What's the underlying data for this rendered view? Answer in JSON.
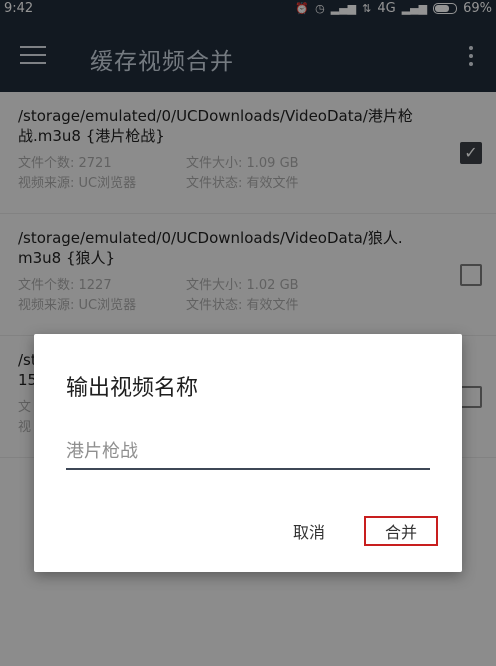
{
  "status_bar": {
    "time": "9:42",
    "network": "4G",
    "battery_level_percent": 69,
    "battery_label": "69%",
    "icons": [
      "alarm-icon",
      "clock-icon",
      "signal-icon",
      "data-arrows-icon",
      "signal-icon",
      "battery-icon"
    ]
  },
  "app_bar": {
    "title": "缓存视频合并"
  },
  "items": [
    {
      "path": "/storage/emulated/0/UCDownloads/VideoData/港片枪战.m3u8 {港片枪战}",
      "file_count": "文件个数: 2721",
      "file_size": "文件大小: 1.09 GB",
      "source": "视频来源: UC浏览器",
      "status": "文件状态: 有效文件",
      "checked": true
    },
    {
      "path": "/storage/emulated/0/UCDownloads/VideoData/狼人.m3u8 {狼人}",
      "file_count": "文件个数: 1227",
      "file_size": "文件大小: 1.02 GB",
      "source": "视频来源: UC浏览器",
      "status": "文件状态: 有效文件",
      "checked": false
    },
    {
      "path": "/st\n15",
      "file_count": "文",
      "file_size": "",
      "source": "视",
      "status": "",
      "checked": false
    }
  ],
  "dialog": {
    "title": "输出视频名称",
    "input_placeholder": "港片枪战",
    "cancel_label": "取消",
    "merge_label": "合并"
  },
  "colors": {
    "app_bar": "#1f2b3a",
    "highlight_border": "#c81e1e"
  }
}
